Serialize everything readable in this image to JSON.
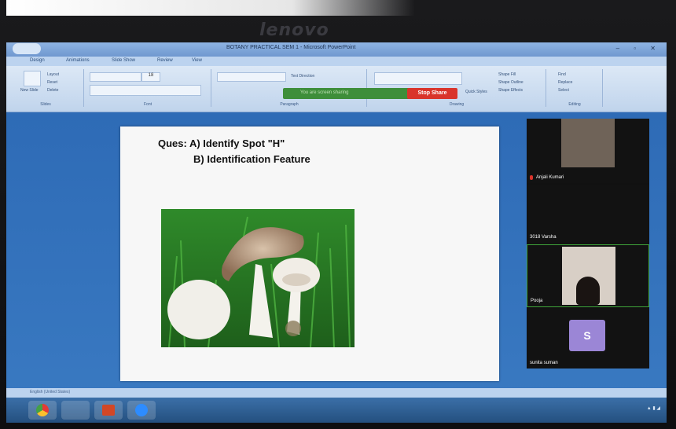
{
  "laptop": {
    "brand": "lenovo"
  },
  "app": {
    "title": "BOTANY PRACTICAL SEM 1 - Microsoft PowerPoint",
    "tabs": [
      "Design",
      "Animations",
      "Slide Show",
      "Review",
      "View"
    ],
    "ribbon": {
      "slides_group": "Slides",
      "font_group": "Font",
      "paragraph_group": "Paragraph",
      "drawing_group": "Drawing",
      "editing_group": "Editing",
      "new_slide": "New Slide",
      "layout": "Layout",
      "reset": "Reset",
      "delete": "Delete",
      "font_size": "18",
      "text_direction": "Text Direction",
      "shape_fill": "Shape Fill",
      "shape_outline": "Shape Outline",
      "shape_effects": "Shape Effects",
      "quick_styles": "Quick Styles",
      "find": "Find",
      "replace": "Replace",
      "select": "Select"
    }
  },
  "meeting": {
    "share_banner": "You are screen sharing",
    "stop_share": "Stop Share",
    "participants": [
      {
        "name": "Anjali Kumari"
      },
      {
        "name": "3018 Varsha"
      },
      {
        "name": "Pooja"
      },
      {
        "name": "sunita suman",
        "initial": "S"
      }
    ]
  },
  "slide": {
    "question_line1": "Ques:  A) Identify Spot \"H\"",
    "question_line2": "B)  Identification Feature"
  },
  "statusbar": {
    "language": "English (United States)"
  },
  "colors": {
    "share_green": "#3e8e3a",
    "stop_red": "#d9342b",
    "avatar_purple": "#9b86d6"
  }
}
